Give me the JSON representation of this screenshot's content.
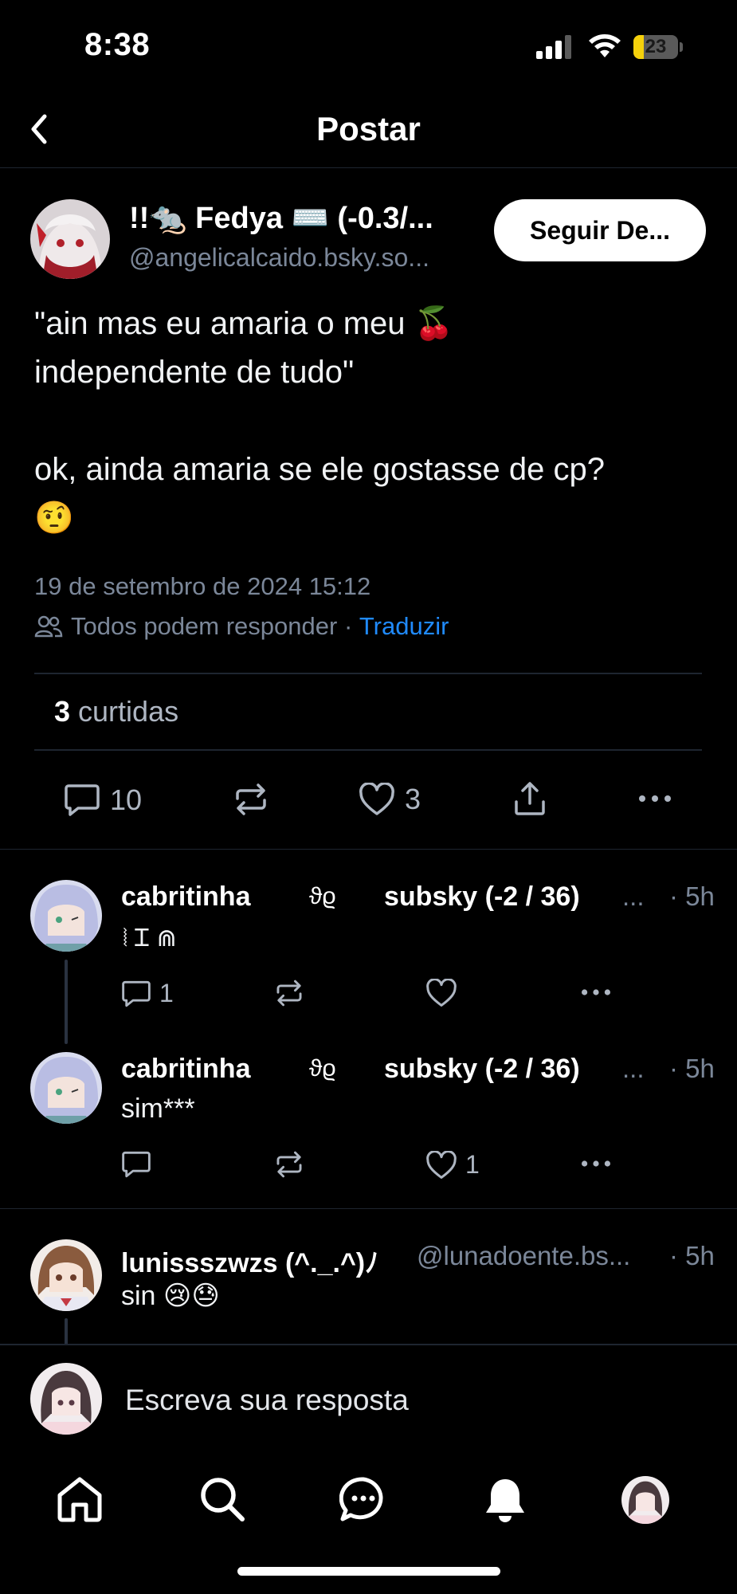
{
  "status_bar": {
    "time": "8:38",
    "battery": "23",
    "battery_level": 0.23
  },
  "header": {
    "title": "Postar",
    "back_icon": "chevron-left-icon"
  },
  "post": {
    "author_name": "!!🐀 Fedya ⌨️ (-0.3/...",
    "author_handle": "@angelicalcaido.bsky.so...",
    "follow_label": "Seguir De...",
    "text": "\"ain mas eu amaria o meu 🍒\nindependente de tudo\"\n\nok, ainda amaria se ele gostasse de cp?\n🤨",
    "date": "19 de setembro de 2024 15:12",
    "reply_setting": "Todos podem responder",
    "separator": " · ",
    "translate": "Traduzir",
    "likes_count": "3",
    "likes_label": " curtidas",
    "actions": {
      "reply_count": "10",
      "like_count": "3"
    }
  },
  "replies": [
    {
      "name": "cabritinha",
      "deco": "ϑϱ",
      "rest": "subsky (-2 / 36)",
      "ellipsis": "...",
      "time": "· 5h",
      "text": "⦚ Ꮖ ⋒",
      "reply_count": "1",
      "like_count": ""
    },
    {
      "name": "cabritinha",
      "deco": "ϑϱ",
      "rest": "subsky (-2 / 36)",
      "ellipsis": "...",
      "time": "· 5h",
      "text": "sim***",
      "reply_count": "",
      "like_count": "1"
    },
    {
      "name": "lunissszwzs (^._.^)ﾉ",
      "handle": "@lunadoente.bs...",
      "time": "· 5h",
      "text": "sin 😢😓"
    }
  ],
  "compose": {
    "placeholder": "Escreva sua resposta"
  },
  "colors": {
    "background": "#000000",
    "accent": "#208bfe",
    "muted": "#7b8799",
    "battery": "#f5d10b"
  }
}
